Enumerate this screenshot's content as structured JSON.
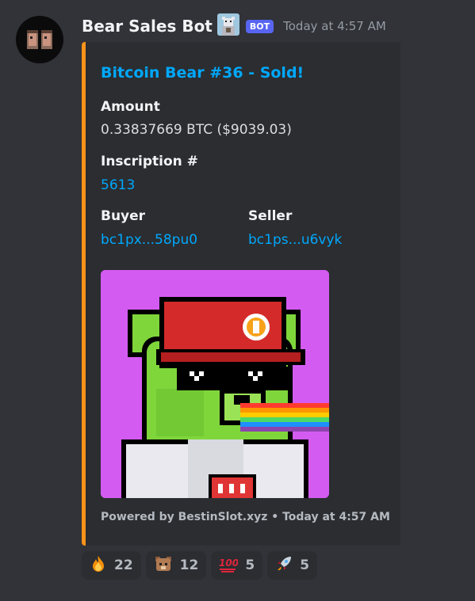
{
  "message": {
    "username": "Bear Sales Bot",
    "bot_tag": "BOT",
    "timestamp": "Today at 4:57 AM"
  },
  "embed": {
    "accent_color": "#f7931a",
    "title": "Bitcoin Bear #36 - Sold!",
    "fields": {
      "amount": {
        "name": "Amount",
        "value": "0.33837669 BTC ($9039.03)"
      },
      "inscription": {
        "name": "Inscription #",
        "value": "5613"
      },
      "buyer": {
        "name": "Buyer",
        "value": "bc1px...58pu0"
      },
      "seller": {
        "name": "Seller",
        "value": "bc1ps...u6vyk"
      }
    },
    "footer": "Powered by BestinSlot.xyz • Today at 4:57 AM"
  },
  "reactions": [
    {
      "emoji": "fire-emoji",
      "count": "22"
    },
    {
      "emoji": "bear-emoji",
      "count": "12"
    },
    {
      "emoji": "hundred-points-emoji",
      "count": "5"
    },
    {
      "emoji": "rocket-emoji",
      "count": "5"
    }
  ]
}
